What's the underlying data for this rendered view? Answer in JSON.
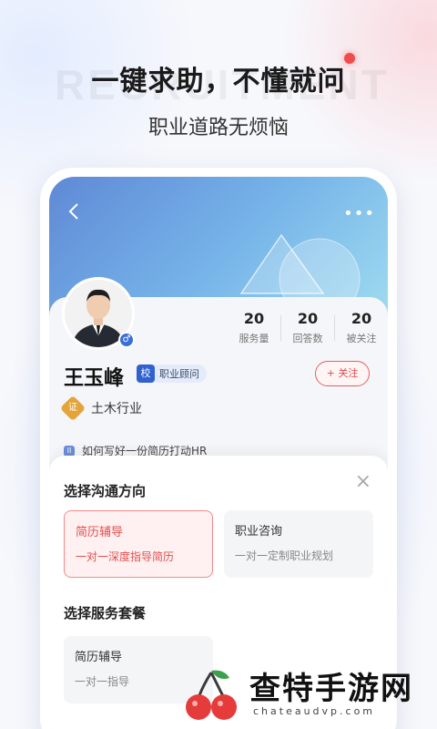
{
  "hero": {
    "title": "一键求助，不懂就问",
    "subtitle": "职业道路无烦恼",
    "watermark": "RECRUITMENT"
  },
  "nav": {
    "back_icon": "chevron-left-icon",
    "more_icon": "more-dots-icon",
    "more_glyph": "•••"
  },
  "profile": {
    "name": "王玉峰",
    "role_badge_icon": "校",
    "role": "职业顾问",
    "follow_label": "+ 关注",
    "industry_icon": "证",
    "industry": "土木行业",
    "gender_icon": "♂",
    "article_icon": "II",
    "article_preview": "如何写好一份简历打动HR",
    "stats": [
      {
        "value": "20",
        "label": "服务量"
      },
      {
        "value": "20",
        "label": "回答数"
      },
      {
        "value": "20",
        "label": "被关注"
      }
    ]
  },
  "sheet": {
    "close_icon": "×",
    "direction_title": "选择沟通方向",
    "directions": [
      {
        "title": "简历辅导",
        "desc": "一对一深度指导简历",
        "selected": true
      },
      {
        "title": "职业咨询",
        "desc": "一对一定制职业规划",
        "selected": false
      }
    ],
    "package_title": "选择服务套餐",
    "packages": [
      {
        "title": "简历辅导",
        "desc": "一对一指导",
        "selected": false
      }
    ]
  },
  "site": {
    "name": "查特手游网",
    "url": "chateaudvp.com"
  },
  "colors": {
    "accent": "#e24e4e",
    "blue": "#2f62cf"
  }
}
